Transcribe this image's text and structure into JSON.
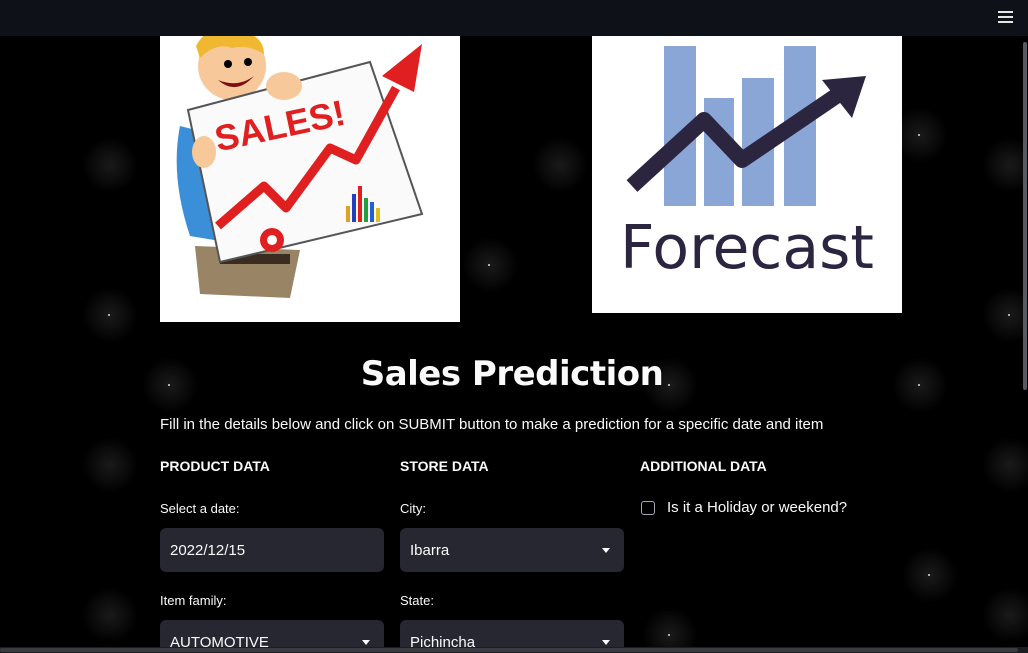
{
  "topbar": {
    "menu_icon": "hamburger-menu-icon"
  },
  "images": {
    "sales": {
      "text": "SALES!"
    },
    "forecast": {
      "text": "Forecast"
    }
  },
  "main": {
    "title": "Sales Prediction",
    "intro": "Fill in the details below and click on SUBMIT button to make a prediction for a specific date and item"
  },
  "product": {
    "heading": "PRODUCT DATA",
    "date_label": "Select a date:",
    "date_value": "2022/12/15",
    "family_label": "Item family:",
    "family_value": "AUTOMOTIVE"
  },
  "store": {
    "heading": "STORE DATA",
    "city_label": "City:",
    "city_value": "Ibarra",
    "state_label": "State:",
    "state_value": "Pichincha"
  },
  "additional": {
    "heading": "ADDITIONAL DATA",
    "holiday_label": "Is it a Holiday or weekend?",
    "holiday_checked": false
  },
  "colors": {
    "background": "#000000",
    "topbar": "#0e1117",
    "input_bg": "#262730",
    "text": "#fafafa",
    "forecast_bars": "#8aa6d6",
    "forecast_arrow": "#2b2540",
    "sales_red": "#e02020"
  }
}
